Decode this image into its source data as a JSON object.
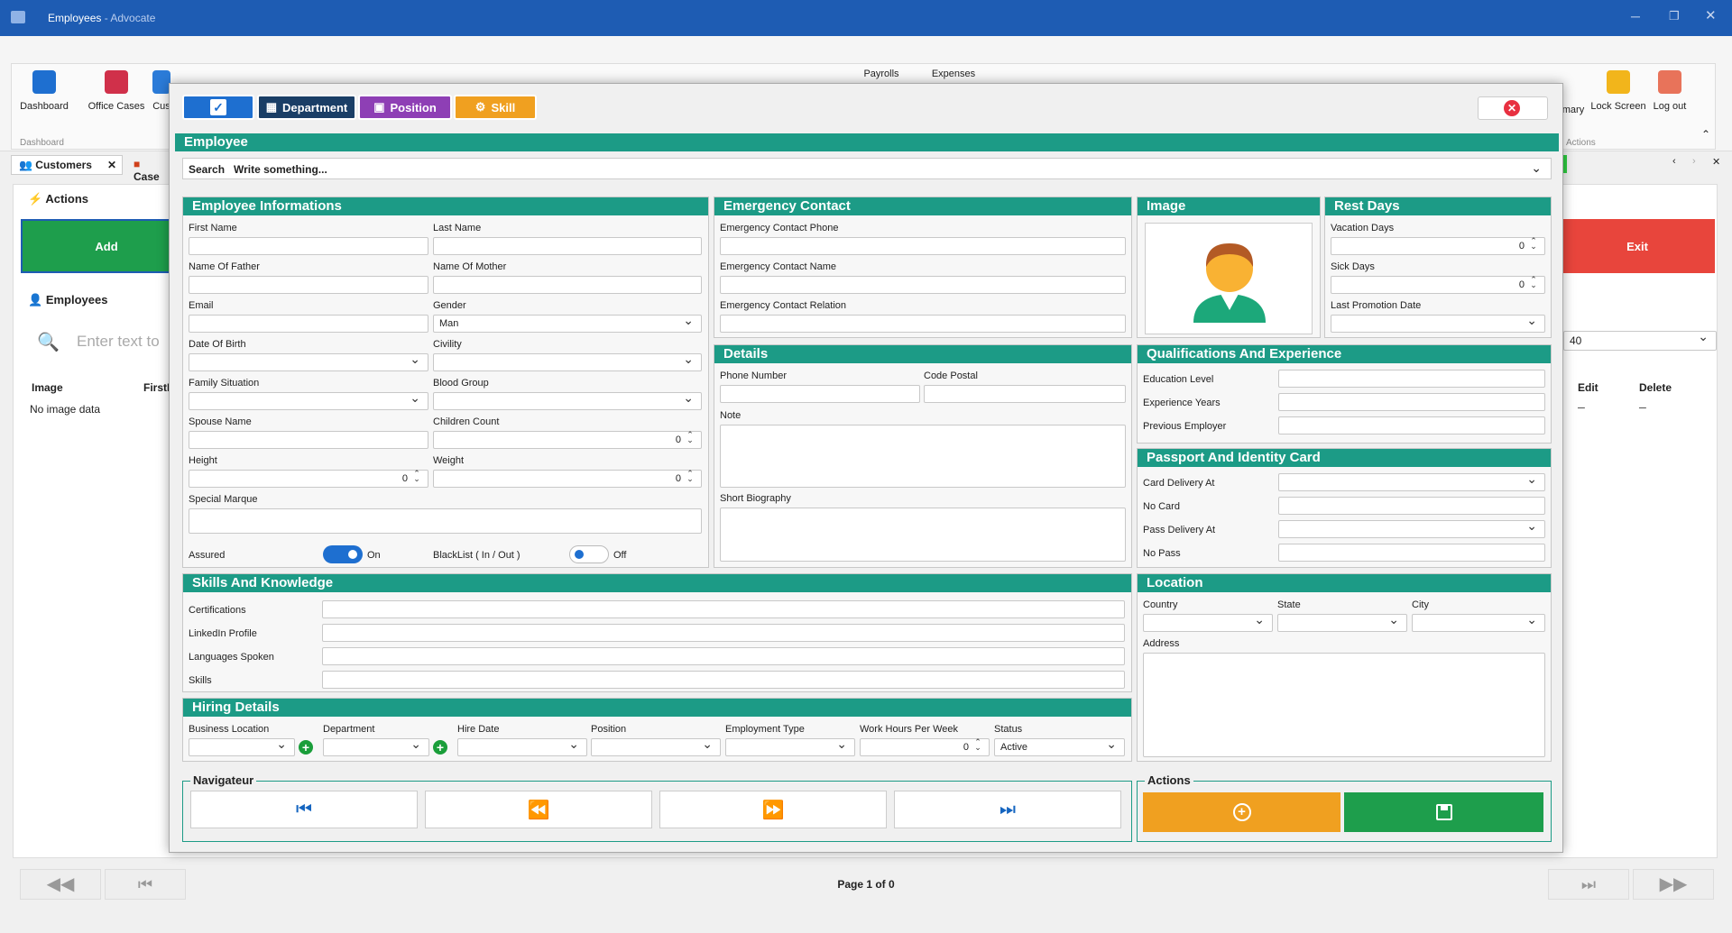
{
  "window": {
    "title": "Employees",
    "app": " - Advocate"
  },
  "ribbon": {
    "items": [
      "Dashboard",
      "Office Cases",
      "Cus",
      "Payrolls",
      "Expenses",
      "mary",
      "Lock Screen",
      "Log out"
    ],
    "group_dashboard": "Dashboard",
    "group_actions": "Actions"
  },
  "tabs": {
    "customers": "Customers",
    "cases": "Case"
  },
  "background": {
    "actions": "Actions",
    "add": "Add",
    "exit": "Exit",
    "employees": "Employees",
    "search_placeholder": "Enter text to",
    "page_size": "40",
    "col_image": "Image",
    "col_first": "FirstN",
    "col_edit": "Edit",
    "col_delete": "Delete",
    "row_image": "No image data",
    "row_edit": "─",
    "row_delete": "─",
    "pager": "Page 1 of 0"
  },
  "dialog": {
    "buttons": {
      "department": "Department",
      "position": "Position",
      "skill": "Skill"
    },
    "title": "Employee",
    "search": {
      "label": "Search",
      "placeholder": "Write something..."
    },
    "info": {
      "header": "Employee Informations",
      "first_name": "First Name",
      "last_name": "Last Name",
      "father": "Name Of Father",
      "mother": "Name Of Mother",
      "email": "Email",
      "gender": "Gender",
      "gender_value": "Man",
      "dob": "Date Of Birth",
      "civility": "Civility",
      "family": "Family Situation",
      "blood": "Blood Group",
      "spouse": "Spouse Name",
      "children": "Children Count",
      "children_value": "0",
      "height": "Height",
      "height_value": "0",
      "weight": "Weight",
      "weight_value": "0",
      "special": "Special Marque",
      "assured": "Assured",
      "assured_state": "On",
      "blacklist": "BlackList ( In / Out )",
      "blacklist_state": "Off"
    },
    "emergency": {
      "header": "Emergency Contact",
      "phone": "Emergency Contact Phone",
      "name": "Emergency Contact Name",
      "relation": "Emergency Contact Relation"
    },
    "image": {
      "header": "Image"
    },
    "rest": {
      "header": "Rest Days",
      "vacation": "Vacation Days",
      "vacation_value": "0",
      "sick": "Sick Days",
      "sick_value": "0",
      "promotion": "Last Promotion Date"
    },
    "details": {
      "header": "Details",
      "phone": "Phone Number",
      "postal": "Code Postal",
      "note": "Note",
      "bio": "Short Biography"
    },
    "qualif": {
      "header": "Qualifications And Experience",
      "education": "Education Level",
      "years": "Experience Years",
      "previous": "Previous Employer"
    },
    "passport": {
      "header": "Passport And Identity Card",
      "card_delivery": "Card Delivery At",
      "no_card": "No Card",
      "pass_delivery": "Pass Delivery At",
      "no_pass": "No Pass"
    },
    "skills": {
      "header": "Skills And Knowledge",
      "certs": "Certifications",
      "linkedin": "LinkedIn Profile",
      "languages": "Languages Spoken",
      "skills": "Skills"
    },
    "location": {
      "header": "Location",
      "country": "Country",
      "state": "State",
      "city": "City",
      "address": "Address"
    },
    "hiring": {
      "header": "Hiring Details",
      "business": "Business Location",
      "department": "Department",
      "hire_date": "Hire Date",
      "position": "Position",
      "type": "Employment Type",
      "hours": "Work Hours Per Week",
      "hours_value": "0",
      "status": "Status",
      "status_value": "Active"
    },
    "nav": {
      "header": "Navigateur"
    },
    "actions": {
      "header": "Actions"
    }
  },
  "colors": {
    "teal": "#1c9b86",
    "blue": "#1e5cb3",
    "purple": "#8e3fb5",
    "orange": "#f0a020",
    "green": "#1e9e4c",
    "red": "#e8453c"
  }
}
